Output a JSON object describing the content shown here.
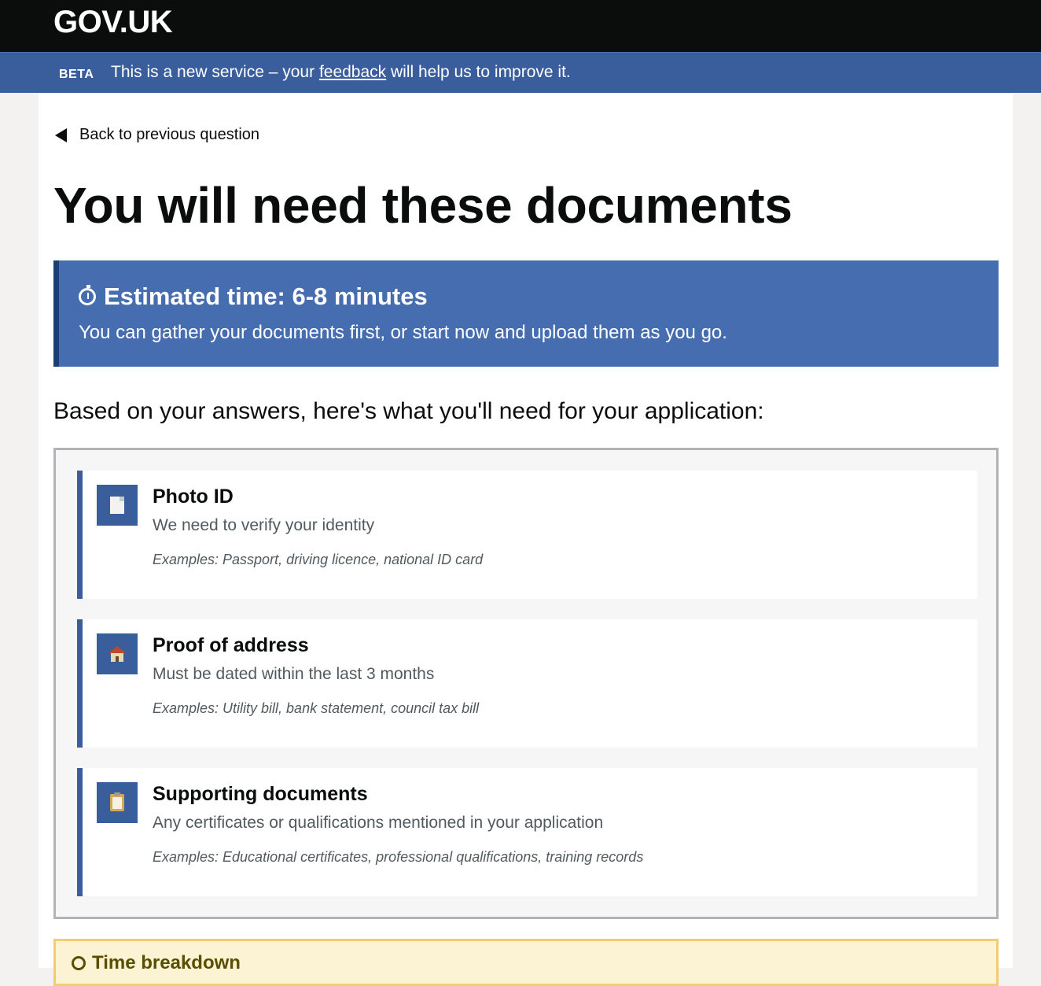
{
  "header": {
    "logo": "GOV.UK"
  },
  "phase_banner": {
    "tag": "BETA",
    "text_before": "This is a new service – your ",
    "link": "feedback",
    "text_after": " will help us to improve it."
  },
  "back_link": "Back to previous question",
  "page_title": "You will need these documents",
  "time_panel": {
    "heading": "Estimated time: 6-8 minutes",
    "body": "You can gather your documents first, or start now and upload them as you go.",
    "icon": "stopwatch-icon"
  },
  "intro": "Based on your answers, here's what you'll need for your application:",
  "documents": [
    {
      "title": "Photo ID",
      "description": "We need to verify your identity",
      "examples": "Examples: Passport, driving licence, national ID card",
      "icon": "document-icon"
    },
    {
      "title": "Proof of address",
      "description": "Must be dated within the last 3 months",
      "examples": "Examples: Utility bill, bank statement, council tax bill",
      "icon": "house-icon"
    },
    {
      "title": "Supporting documents",
      "description": "Any certificates or qualifications mentioned in your application",
      "examples": "Examples: Educational certificates, professional qualifications, training records",
      "icon": "clipboard-icon"
    }
  ],
  "breakdown": {
    "title": "Time breakdown"
  },
  "colors": {
    "header_bg": "#0b0c0c",
    "banner_bg": "#3a5e9c",
    "panel_bg": "#466daf",
    "accent": "#3a5e9c",
    "breakdown_bg": "#fbf3d4",
    "breakdown_border": "#f0cd70"
  }
}
